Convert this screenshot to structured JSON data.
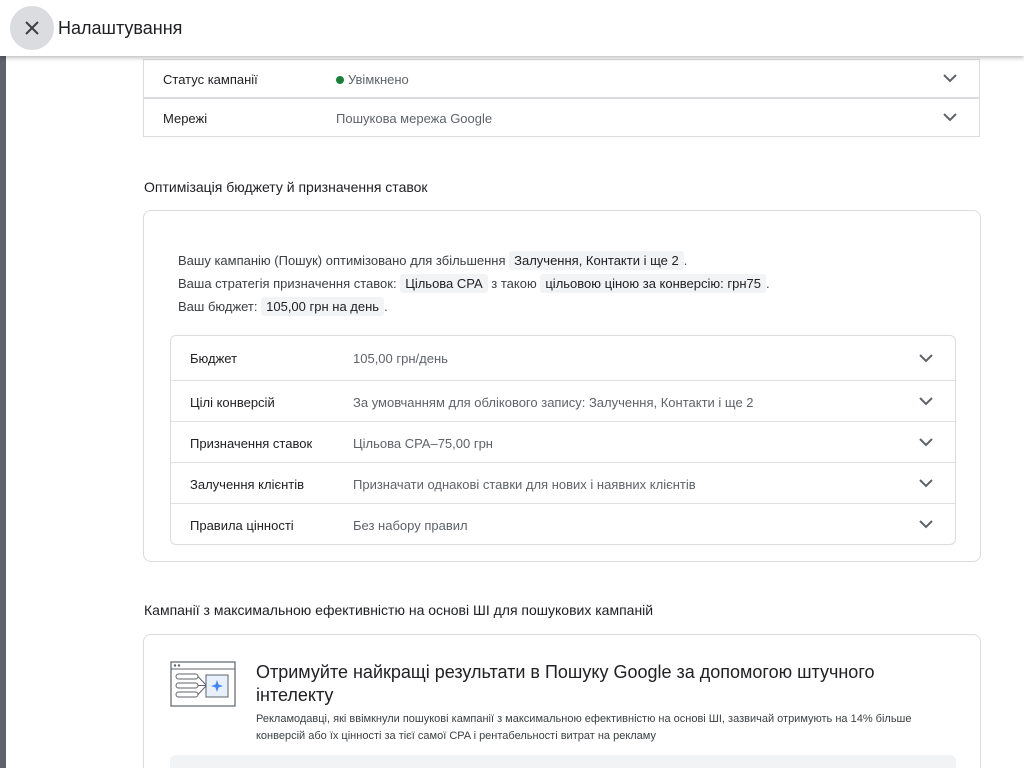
{
  "header": {
    "title": "Налаштування"
  },
  "campaign_rows": [
    {
      "label": "Статус кампанії",
      "value": "Увімкнено",
      "status_color": "#188038"
    },
    {
      "label": "Мережі",
      "value": "Пошукова мережа Google"
    }
  ],
  "budget_section": {
    "title": "Оптимізація бюджету й призначення ставок",
    "summary": {
      "line1_prefix": "Вашу кампанію (Пошук) оптимізовано для збільшення",
      "line1_chip": "Залучення, Контакти і ще 2",
      "line1_suffix": ".",
      "line2_prefix": "Ваша стратегія призначення ставок:",
      "line2_chip1": "Цільова CPA",
      "line2_mid": "з такою",
      "line2_chip2": "цільовою ціною за конверсію: грн75",
      "line2_suffix": ".",
      "line3_prefix": "Ваш бюджет:",
      "line3_chip": "105,00 грн на день",
      "line3_suffix": "."
    },
    "rows": [
      {
        "label": "Бюджет",
        "value": "105,00 грн/день"
      },
      {
        "label": "Цілі конверсій",
        "value": "За умовчанням для облікового запису: Залучення, Контакти і ще 2"
      },
      {
        "label": "Призначення ставок",
        "value": "Цільова CPA–75,00 грн"
      },
      {
        "label": "Залучення клієнтів",
        "value": "Призначати однакові ставки для нових і наявних клієнтів"
      },
      {
        "label": "Правила цінності",
        "value": "Без набору правил"
      }
    ]
  },
  "ai_section": {
    "title": "Кампанії з максимальною ефективністю на основі ШІ для пошукових кампаній",
    "heading": "Отримуйте найкращі результати в Пошуку Google за допомогою штучного інтелекту",
    "description": "Рекламодавці, які ввімкнули пошукові кампанії з максимальною ефективністю на основі ШІ, зазвичай отримують на 14% більше конверсій або їх цінності за тієї самої CPA і рентабельності витрат на рекламу"
  },
  "icons": {
    "close": "close-icon",
    "expand": "chevron-down-icon",
    "illustration": "ai-search-illustration-icon"
  }
}
